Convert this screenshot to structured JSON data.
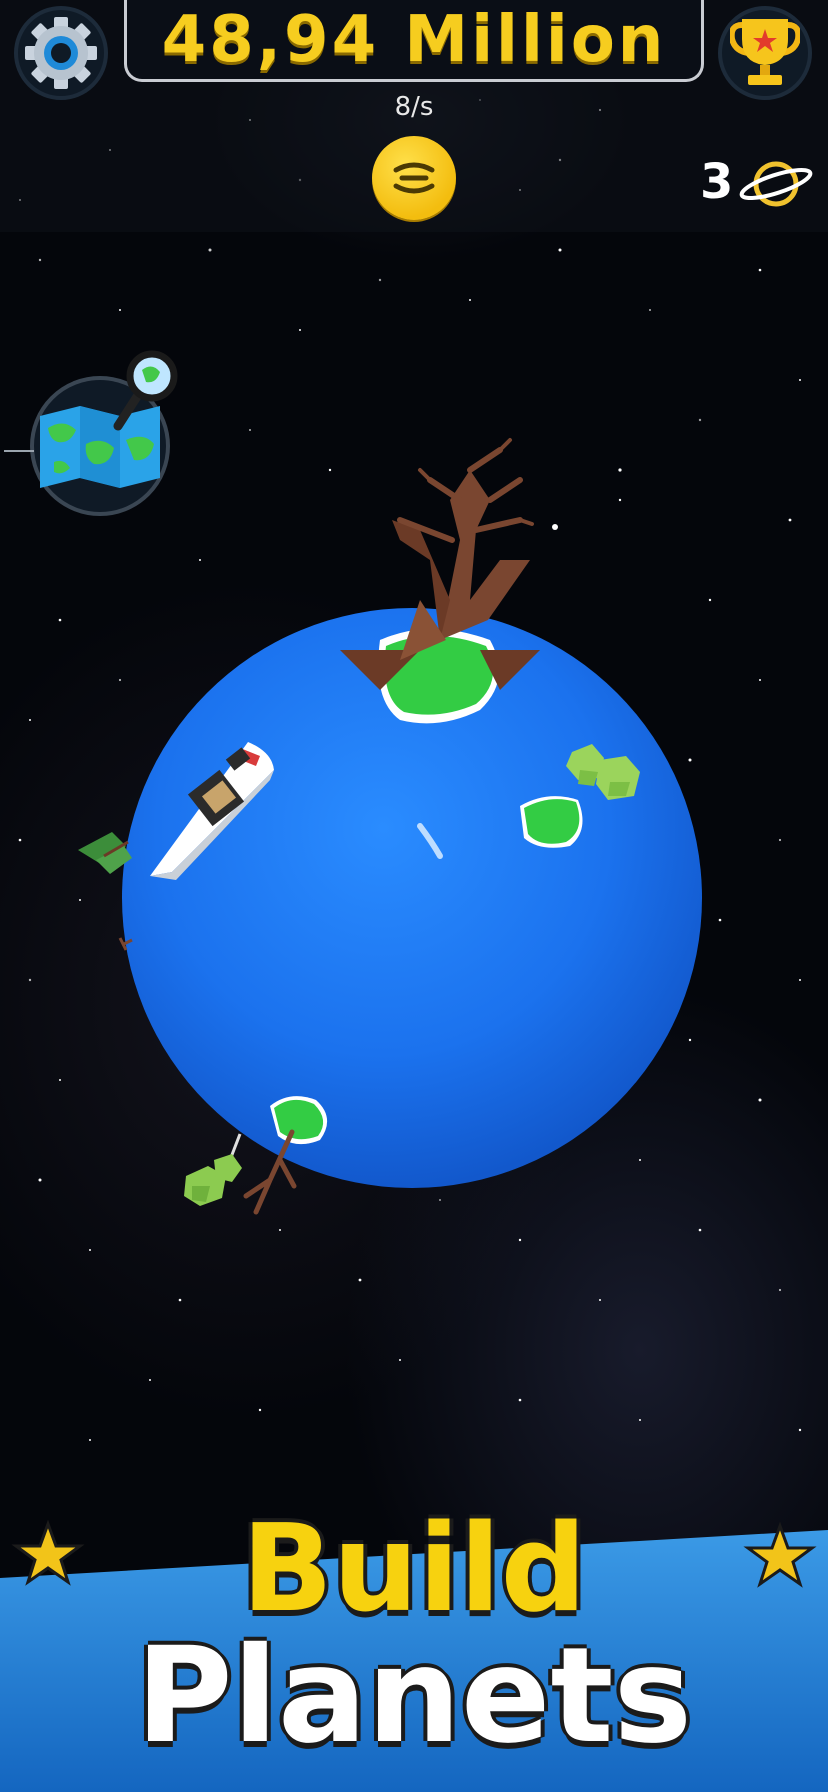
{
  "hud": {
    "money_label": "48,94 Million",
    "rate_label": "8/s",
    "planet_count": "3",
    "icons": {
      "settings": "gear-icon",
      "leaderboard": "trophy-icon",
      "currency": "coin-icon",
      "planets": "ringed-planet-icon",
      "map": "world-map-magnifier-icon"
    }
  },
  "banner": {
    "line1": "Build",
    "line2": "Planets"
  },
  "colors": {
    "money": "#f6cd1f",
    "ocean": "#1e78f0",
    "banner_blue": "#1c7ed6",
    "title_yellow": "#f7d20f"
  }
}
